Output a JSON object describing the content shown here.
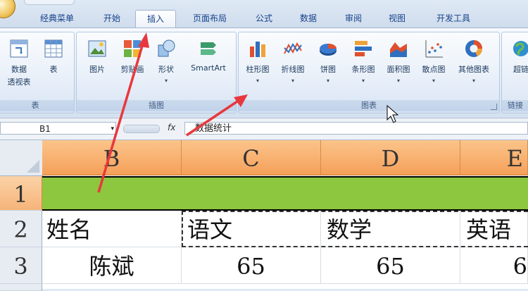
{
  "tabs": [
    {
      "label": "经典菜单"
    },
    {
      "label": "开始"
    },
    {
      "label": "插入"
    },
    {
      "label": "页面布局"
    },
    {
      "label": "公式"
    },
    {
      "label": "数据"
    },
    {
      "label": "审阅"
    },
    {
      "label": "视图"
    },
    {
      "label": "开发工具"
    }
  ],
  "active_tab": "插入",
  "ribbon": {
    "table_group": {
      "title": "表",
      "pivot_label_1": "数据",
      "pivot_label_2": "透视表",
      "table_label": "表"
    },
    "illustrations_group": {
      "title": "插图",
      "picture": "图片",
      "clipart": "剪贴画",
      "shapes": "形状",
      "smartart": "SmartArt"
    },
    "charts_group": {
      "title": "图表",
      "column": "柱形图",
      "line": "折线图",
      "pie": "饼图",
      "bar": "条形图",
      "area": "面积图",
      "scatter": "散点图",
      "other": "其他图表"
    },
    "links_group": {
      "title": "链接",
      "hyperlink": "超链"
    },
    "dropdown_glyph": "▾"
  },
  "formula_bar": {
    "name_box": "B1",
    "fx": "fx",
    "content": "数据统计"
  },
  "sheet": {
    "columns": [
      "B",
      "C",
      "D",
      "E"
    ],
    "rows": [
      "1",
      "2",
      "3"
    ],
    "row2": [
      "姓名",
      "语文",
      "数学",
      "英语"
    ],
    "row3": [
      "陈斌",
      "65",
      "65",
      "6"
    ],
    "header_color": "#f5a05a",
    "title_row_color": "#8dc63f"
  },
  "annotation_color": "#e8383d"
}
